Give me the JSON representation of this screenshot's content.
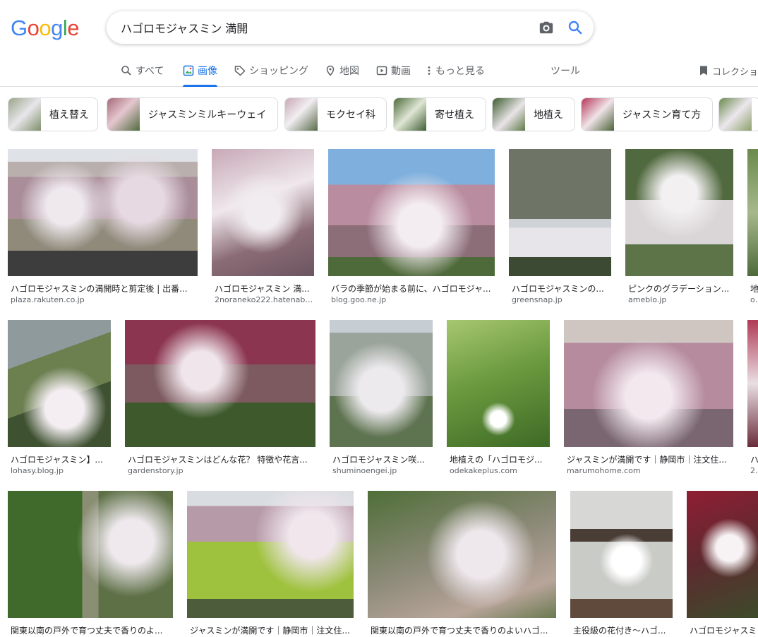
{
  "logo": {
    "letters": [
      "G",
      "o",
      "o",
      "g",
      "l",
      "e"
    ],
    "colors": [
      "#4285F4",
      "#EA4335",
      "#FBBC05",
      "#4285F4",
      "#34A853",
      "#EA4335"
    ]
  },
  "search": {
    "value": "ハゴロモジャスミン 満開"
  },
  "tabs": [
    {
      "label": "すべて",
      "icon": "search-icon"
    },
    {
      "label": "画像",
      "icon": "image-icon",
      "active": true
    },
    {
      "label": "ショッピング",
      "icon": "tag-icon"
    },
    {
      "label": "地図",
      "icon": "map-pin-icon"
    },
    {
      "label": "動画",
      "icon": "play-icon"
    },
    {
      "label": "もっと見る",
      "icon": "more-vert-icon"
    },
    {
      "label": "ツール"
    },
    {
      "label": "コレクショ",
      "icon": "bookmark-icon"
    }
  ],
  "chips": [
    {
      "label": "植え替え"
    },
    {
      "label": "ジャスミンミルキーウェイ"
    },
    {
      "label": "モクセイ科"
    },
    {
      "label": "寄せ植え"
    },
    {
      "label": "地植え"
    },
    {
      "label": "ジャスミン育て方"
    },
    {
      "label": ""
    }
  ],
  "results": [
    {
      "title": "ハゴロモジャスミンの満開時と剪定後 | 出番...",
      "source": "plaza.rakuten.co.jp"
    },
    {
      "title": "ハゴロモジャスミン 満...",
      "source": "2noraneko222.hatenablo..."
    },
    {
      "title": "バラの季節が始まる前に、ハゴロモジャ...",
      "source": "blog.goo.ne.jp"
    },
    {
      "title": "ハゴロモジャスミンの...",
      "source": "greensnap.jp"
    },
    {
      "title": "ピンクのグラデーション...",
      "source": "ameblo.jp"
    },
    {
      "title": "地...",
      "source": "oc"
    },
    {
      "title": "ハゴロモジャスミン】...",
      "source": "lohasy.blog.jp"
    },
    {
      "title": "ハゴロモジャスミンはどんな花？ 特徴や花言...",
      "source": "gardenstory.jp"
    },
    {
      "title": "ハゴロモジャスミン咲...",
      "source": "shuminoengei.jp"
    },
    {
      "title": "地植えの「ハゴロモジ...",
      "source": "odekakeplus.com"
    },
    {
      "title": "ジャスミンが満開です｜静岡市｜注文住...",
      "source": "marumohome.com"
    },
    {
      "title": "ハ...",
      "source": "2r"
    },
    {
      "title": "関東以南の戸外で育つ丈夫で香りのよ...",
      "source": ""
    },
    {
      "title": "ジャスミンが満開です｜静岡市｜注文住...",
      "source": ""
    },
    {
      "title": "関東以南の戸外で育つ丈夫で香りのよいハゴ...",
      "source": ""
    },
    {
      "title": "主役級の花付き～ハゴ...",
      "source": ""
    },
    {
      "title": "ハゴロモジャスミ",
      "source": ""
    }
  ]
}
